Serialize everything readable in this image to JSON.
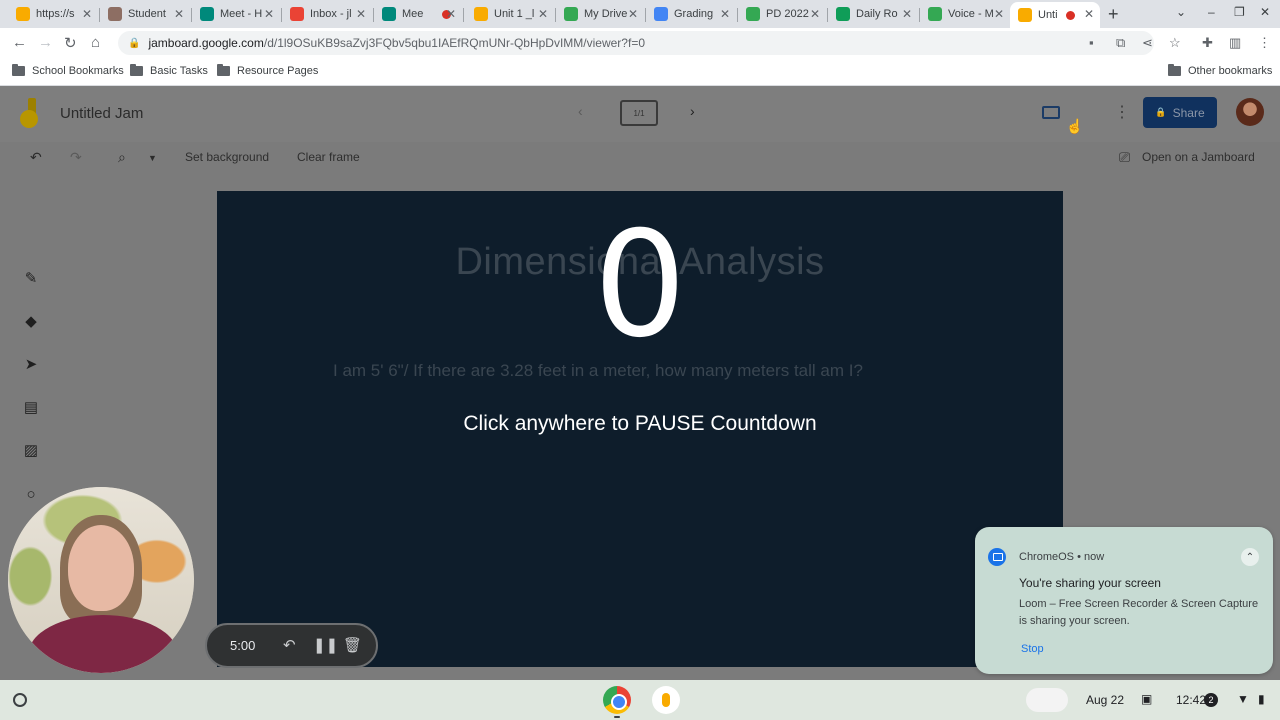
{
  "browser": {
    "tabs": [
      {
        "label": "https://s",
        "color": "#f9ab00",
        "glyph": "•"
      },
      {
        "label": "Student",
        "color": "#8d6e63",
        "glyph": "S"
      },
      {
        "label": "Meet - H",
        "color": "#00897b",
        "glyph": "M"
      },
      {
        "label": "Inbox - jl",
        "color": "#ea4335",
        "glyph": "M"
      },
      {
        "label": "Mee",
        "color": "#00897b",
        "glyph": "M"
      },
      {
        "label": "Unit 1 _l",
        "color": "#f9ab00",
        "glyph": "▭"
      },
      {
        "label": "My Drive",
        "color": "#34a853",
        "glyph": "▲"
      },
      {
        "label": "Grading",
        "color": "#4285f4",
        "glyph": "≡"
      },
      {
        "label": "PD 2022",
        "color": "#34a853",
        "glyph": "▲"
      },
      {
        "label": "Daily Ro",
        "color": "#0f9d58",
        "glyph": "+"
      },
      {
        "label": "Voice - M",
        "color": "#34a853",
        "glyph": "☏"
      },
      {
        "label": "Unti",
        "color": "#f9ab00",
        "glyph": "J"
      }
    ],
    "new_tab": "+",
    "url_domain": "jamboard.google.com",
    "url_path": "/d/1l9OSuKB9saZvj3FQbv5qbu1IAEfRQmUNr-QbHpDvIMM/viewer?f=0",
    "bookmarks": [
      "School Bookmarks",
      "Basic Tasks",
      "Resource Pages"
    ],
    "other_bookmarks": "Other bookmarks"
  },
  "jamboard": {
    "title": "Untitled Jam",
    "frame_counter": "1/1",
    "share_label": "Share",
    "toolbar": {
      "set_background": "Set background",
      "clear_frame": "Clear frame",
      "open_on_jamboard": "Open on a Jamboard"
    },
    "frame": {
      "title": "Dimensional Analysis",
      "question": "I am 5' 6\"/ If there are 3.28 feet in a meter, how many meters tall am I?"
    }
  },
  "countdown": {
    "digit": "0",
    "hint": "Click anywhere to PAUSE Countdown"
  },
  "recorder": {
    "time": "5:00"
  },
  "notification": {
    "source": "ChromeOS • now",
    "title": "You're sharing your screen",
    "body": "Loom – Free Screen Recorder & Screen Capture is sharing your screen.",
    "action": "Stop"
  },
  "shelf": {
    "date": "Aug 22",
    "time": "12:42",
    "notification_count": "2"
  }
}
